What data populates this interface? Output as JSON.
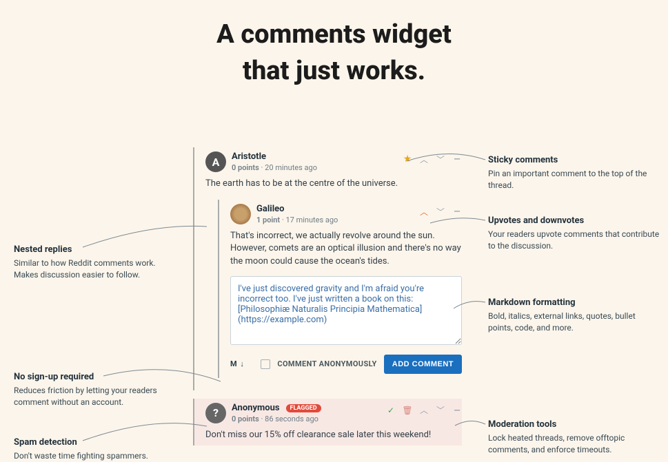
{
  "headline_line1": "A comments widget",
  "headline_line2": "that just works.",
  "comments": [
    {
      "author": "Aristotle",
      "points": "0 points",
      "time": "20 minutes ago",
      "body": "The earth has to be at the centre of the universe."
    },
    {
      "author": "Galileo",
      "points": "1 point",
      "time": "17 minutes ago",
      "body": "That's incorrect, we actually revolve around the sun. However, comets are an optical illusion and there's no way the moon could cause the ocean's tides."
    },
    {
      "author": "Anonymous",
      "flag": "FLAGGED",
      "points": "0 points",
      "time": "86 seconds ago",
      "body": "Don't miss our 15% off clearance sale later this weekend!"
    }
  ],
  "editor_value": "I've just discovered gravity and I'm afraid you're incorrect too. I've just written a book on this: [Philosophiæ Naturalis Principia Mathematica](https://example.com)",
  "editor_bar": {
    "markdown": "M ↓",
    "anon_label": "COMMENT ANONYMOUSLY",
    "add_button": "ADD COMMENT"
  },
  "callouts": {
    "sticky": {
      "title": "Sticky comments",
      "desc": "Pin an important comment to the top of the thread."
    },
    "votes": {
      "title": "Upvotes and downvotes",
      "desc": "Your readers upvote comments that contribute to the discussion."
    },
    "markdown": {
      "title": "Markdown formatting",
      "desc": "Bold, italics, external links, quotes, bullet points, code, and more."
    },
    "mod": {
      "title": "Moderation tools",
      "desc": "Lock heated threads, remove offtopic comments, and enforce timeouts."
    },
    "nested": {
      "title": "Nested replies",
      "desc": "Similar to how Reddit comments work. Makes discussion easier to follow."
    },
    "nosignup": {
      "title": "No sign-up required",
      "desc": "Reduces friction by letting your readers comment without an account."
    },
    "spam": {
      "title": "Spam detection",
      "desc": "Don't waste time fighting spammers."
    }
  }
}
